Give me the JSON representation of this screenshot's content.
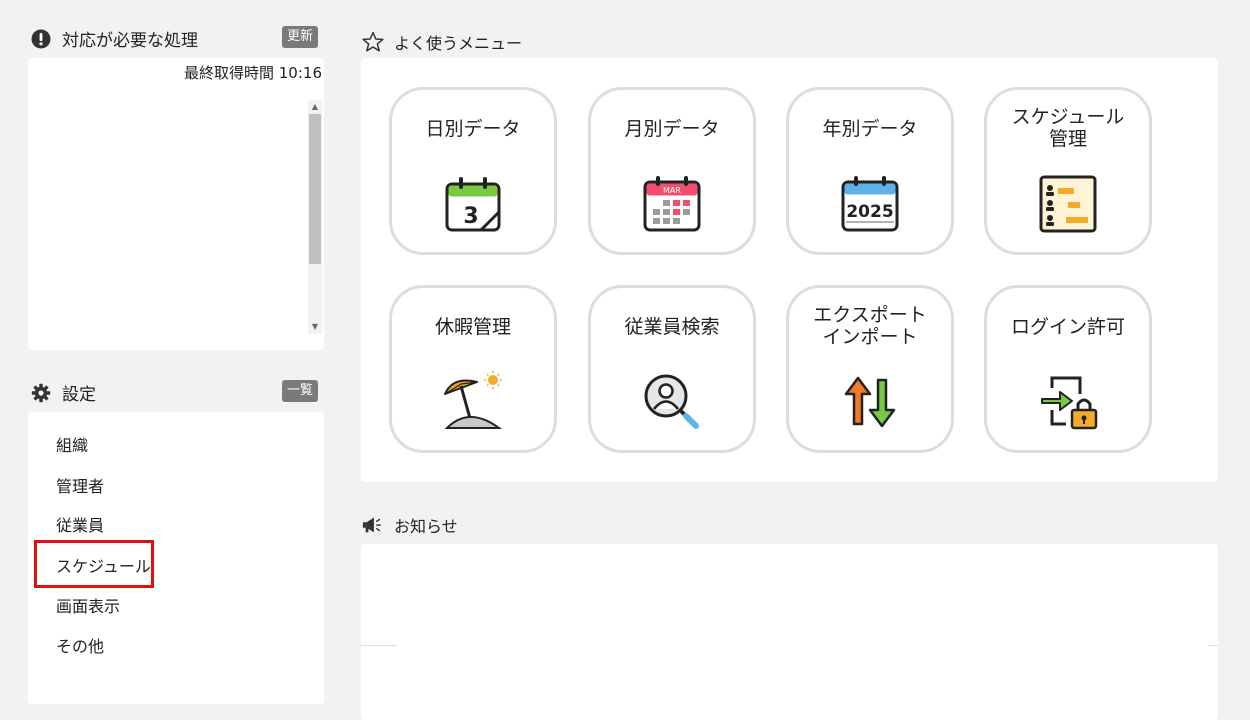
{
  "pending": {
    "title": "対応が必要な処理",
    "refresh_label": "更新",
    "last_fetched": "最終取得時間 10:16"
  },
  "settings": {
    "title": "設定",
    "list_label": "一覧",
    "items": [
      {
        "label": "組織"
      },
      {
        "label": "管理者"
      },
      {
        "label": "従業員"
      },
      {
        "label": "スケジュール"
      },
      {
        "label": "画面表示"
      },
      {
        "label": "その他"
      }
    ]
  },
  "favorites": {
    "title": "よく使うメニュー",
    "tiles": [
      {
        "line1": "日別データ",
        "line2": "",
        "icon": "calendar-day-icon"
      },
      {
        "line1": "月別データ",
        "line2": "",
        "icon": "calendar-month-icon"
      },
      {
        "line1": "年別データ",
        "line2": "",
        "icon": "calendar-year-icon"
      },
      {
        "line1": "スケジュール",
        "line2": "管理",
        "icon": "schedule-chart-icon"
      },
      {
        "line1": "休暇管理",
        "line2": "",
        "icon": "beach-umbrella-icon"
      },
      {
        "line1": "従業員検索",
        "line2": "",
        "icon": "person-search-icon"
      },
      {
        "line1": "エクスポート",
        "line2": "インポート",
        "icon": "up-down-arrows-icon"
      },
      {
        "line1": "ログイン許可",
        "line2": "",
        "icon": "login-lock-icon"
      }
    ],
    "icon_text": {
      "day": "3",
      "month": "MAR",
      "year": "2025"
    }
  },
  "notices": {
    "title": "お知らせ"
  }
}
